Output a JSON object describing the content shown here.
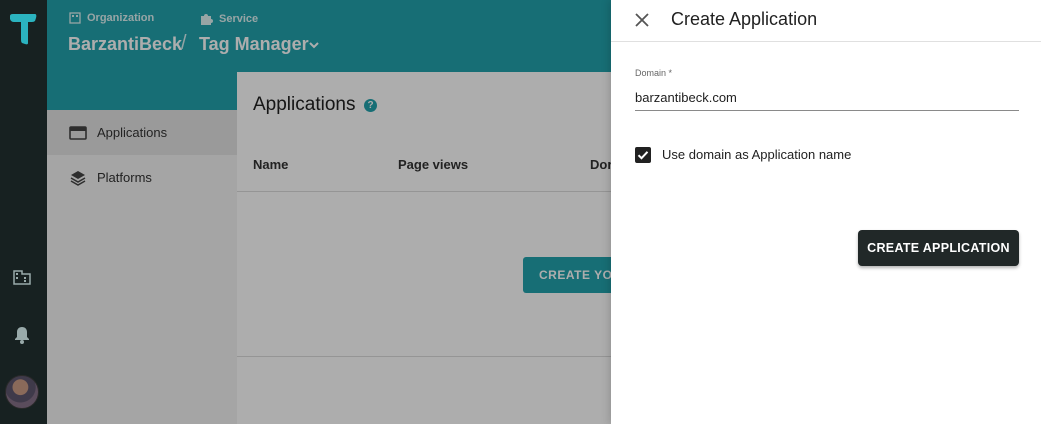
{
  "header": {
    "org_label": "Organization",
    "service_label": "Service",
    "org_name": "BarzantiBeck",
    "separator": "/",
    "service_name": "Tag Manager"
  },
  "sidebar": {
    "items": [
      {
        "label": "Applications",
        "icon": "applications-icon",
        "active": true
      },
      {
        "label": "Platforms",
        "icon": "layers-icon",
        "active": false
      }
    ]
  },
  "main": {
    "title": "Applications",
    "help": "?",
    "columns": [
      "Name",
      "Page views",
      "Dor"
    ],
    "cta_label": "CREATE YOU"
  },
  "rail": {
    "icons": [
      "logo-icon",
      "building-icon",
      "bell-icon",
      "avatar"
    ]
  },
  "drawer": {
    "title": "Create Application",
    "domain_label": "Domain *",
    "domain_value": "barzantibeck.com",
    "checkbox_label": "Use domain as Application name",
    "checkbox_checked": true,
    "submit_label": "CREATE APPLICATION"
  },
  "colors": {
    "brand": "#23a2ad",
    "rail": "#172121",
    "button": "#212828"
  }
}
